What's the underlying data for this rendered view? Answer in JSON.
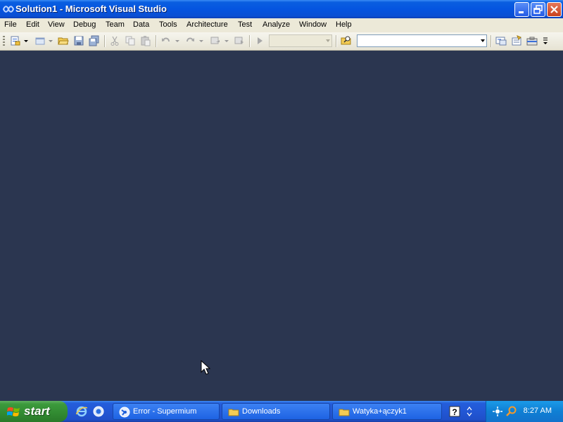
{
  "window": {
    "title": "Solution1 - Microsoft Visual Studio"
  },
  "menubar": {
    "items": [
      "File",
      "Edit",
      "View",
      "Debug",
      "Team",
      "Data",
      "Tools",
      "Architecture",
      "Test",
      "Analyze",
      "Window",
      "Help"
    ]
  },
  "toolbar": {
    "solution_config_value": "",
    "find_value": ""
  },
  "taskbar": {
    "start_label": "start",
    "tasks": [
      {
        "label": "Error - Supermium",
        "icon": "browser-icon"
      },
      {
        "label": "Downloads",
        "icon": "folder-icon"
      },
      {
        "label": "Watyka+ączyk1",
        "icon": "folder-icon"
      }
    ],
    "clock": "8:27 AM"
  },
  "colors": {
    "workspace": "#2b3650",
    "titlebar": "#0554e0",
    "menubar": "#ece9d8",
    "taskbar": "#245edb",
    "start_button": "#3c9a3c"
  }
}
